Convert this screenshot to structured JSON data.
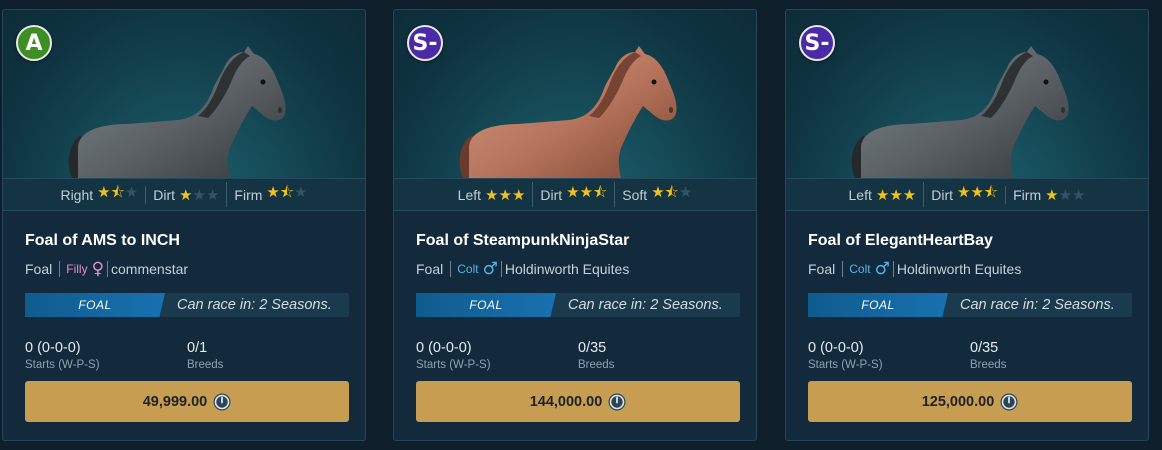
{
  "colors": {
    "grade_a": "#3e8e25",
    "grade_s": "#4a2aa6",
    "filly": "#e48fc5",
    "colt": "#4fb5ea",
    "price_button": "#c69d51",
    "foal_badge": "#1971b0",
    "star_on": "#f1c21b",
    "star_off": "#2f5566"
  },
  "cards": [
    {
      "grade": "A",
      "grade_color": "#3e8e25",
      "horse_coat": "dark-grey",
      "surfaces": [
        {
          "label": "Right",
          "rating": 1.5
        },
        {
          "label": "Dirt",
          "rating": 1
        },
        {
          "label": "Firm",
          "rating": 1.5
        }
      ],
      "name": "Foal of AMS to INCH",
      "type": "Foal",
      "sex": "Filly",
      "sex_icon": "female-icon",
      "sex_color": "#e48fc5",
      "owner": "commenstar",
      "badge": "FOAL",
      "season_text": "Can race in: 2 Seasons.",
      "starts_value": "0 (0-0-0)",
      "starts_label": "Starts (W-P-S)",
      "breeds_value": "0/1",
      "breeds_label": "Breeds",
      "price": "49,999.00",
      "currency_icon": "zed-token-icon"
    },
    {
      "grade": "S-",
      "grade_color": "#4a2aa6",
      "horse_coat": "chestnut",
      "surfaces": [
        {
          "label": "Left",
          "rating": 3
        },
        {
          "label": "Dirt",
          "rating": 2.5
        },
        {
          "label": "Soft",
          "rating": 1.5
        }
      ],
      "name": "Foal of SteampunkNinjaStar",
      "type": "Foal",
      "sex": "Colt",
      "sex_icon": "male-icon",
      "sex_color": "#4fb5ea",
      "owner": "Holdinworth Equites",
      "badge": "FOAL",
      "season_text": "Can race in: 2 Seasons.",
      "starts_value": "0 (0-0-0)",
      "starts_label": "Starts (W-P-S)",
      "breeds_value": "0/35",
      "breeds_label": "Breeds",
      "price": "144,000.00",
      "currency_icon": "zed-token-icon"
    },
    {
      "grade": "S-",
      "grade_color": "#4a2aa6",
      "horse_coat": "dark-grey",
      "surfaces": [
        {
          "label": "Left",
          "rating": 3
        },
        {
          "label": "Dirt",
          "rating": 2.5
        },
        {
          "label": "Firm",
          "rating": 1
        }
      ],
      "name": "Foal of ElegantHeartBay",
      "type": "Foal",
      "sex": "Colt",
      "sex_icon": "male-icon",
      "sex_color": "#4fb5ea",
      "owner": "Holdinworth Equites",
      "badge": "FOAL",
      "season_text": "Can race in: 2 Seasons.",
      "starts_value": "0 (0-0-0)",
      "starts_label": "Starts (W-P-S)",
      "breeds_value": "0/35",
      "breeds_label": "Breeds",
      "price": "125,000.00",
      "currency_icon": "zed-token-icon"
    }
  ]
}
